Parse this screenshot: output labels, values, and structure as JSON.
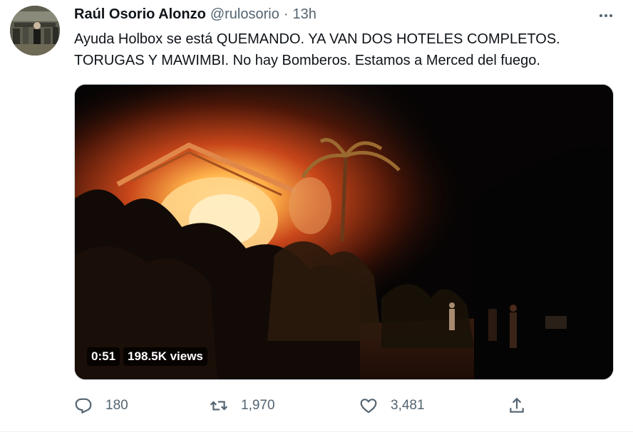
{
  "tweet": {
    "author": {
      "display_name": "Raúl Osorio Alonzo",
      "handle": "@rulosorio",
      "separator": "·",
      "time": "13h"
    },
    "text_lines": [
      "Ayuda Holbox se está QUEMANDO. YA VAN DOS HOTELES COMPLETOS.",
      "TORUGAS Y MAWIMBI. No hay Bomberos. Estamos a Merced del fuego."
    ],
    "video": {
      "duration": "0:51",
      "views": "198.5K views"
    },
    "actions": {
      "reply_count": "180",
      "retweet_count": "1,970",
      "like_count": "3,481"
    }
  },
  "icons": {
    "more": "more-options-icon",
    "reply": "reply-icon",
    "retweet": "retweet-icon",
    "like": "heart-icon",
    "share": "share-icon"
  },
  "colors": {
    "text_primary": "#0f1419",
    "text_secondary": "#536471",
    "border": "#cfd9de"
  }
}
